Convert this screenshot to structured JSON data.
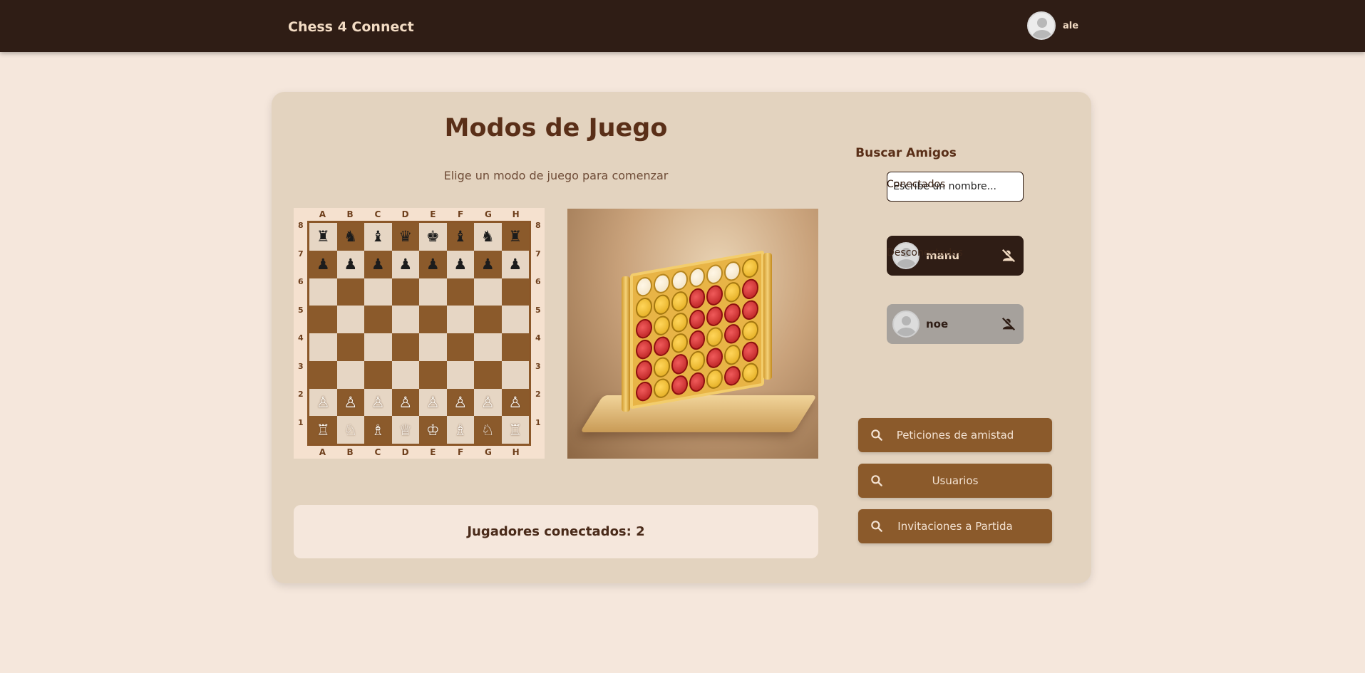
{
  "navbar": {
    "brand": "Chess 4 Connect",
    "user_name": "ale"
  },
  "main": {
    "title": "Modos de Juego",
    "subtitle": "Elige un modo de juego para comenzar",
    "status": "Jugadores conectados: 2",
    "chess": {
      "files": [
        "A",
        "B",
        "C",
        "D",
        "E",
        "F",
        "G",
        "H"
      ],
      "ranks": [
        "8",
        "7",
        "6",
        "5",
        "4",
        "3",
        "2",
        "1"
      ],
      "rows": [
        [
          "♜",
          "♞",
          "♝",
          "♛",
          "♚",
          "♝",
          "♞",
          "♜"
        ],
        [
          "♟",
          "♟",
          "♟",
          "♟",
          "♟",
          "♟",
          "♟",
          "♟"
        ],
        [
          "",
          "",
          "",
          "",
          "",
          "",
          "",
          ""
        ],
        [
          "",
          "",
          "",
          "",
          "",
          "",
          "",
          ""
        ],
        [
          "",
          "",
          "",
          "",
          "",
          "",
          "",
          ""
        ],
        [
          "",
          "",
          "",
          "",
          "",
          "",
          "",
          ""
        ],
        [
          "♙",
          "♙",
          "♙",
          "♙",
          "♙",
          "♙",
          "♙",
          "♙"
        ],
        [
          "♖",
          "♘",
          "♗",
          "♕",
          "♔",
          "♗",
          "♘",
          "♖"
        ]
      ]
    },
    "connect4": {
      "rows": [
        [
          "e",
          "e",
          "e",
          "e",
          "e",
          "e",
          "y"
        ],
        [
          "y",
          "y",
          "y",
          "r",
          "r",
          "y",
          "r"
        ],
        [
          "r",
          "y",
          "y",
          "r",
          "r",
          "r",
          "r"
        ],
        [
          "r",
          "r",
          "y",
          "r",
          "y",
          "r",
          "y"
        ],
        [
          "r",
          "y",
          "r",
          "y",
          "r",
          "y",
          "r"
        ],
        [
          "r",
          "y",
          "r",
          "r",
          "y",
          "r",
          "y"
        ]
      ]
    }
  },
  "friends": {
    "title": "Buscar Amigos",
    "search_placeholder": "Escribe un nombre...",
    "connected_label": "Conectados",
    "disconnected_label": "Desconectados",
    "connected": [
      {
        "name": "manu"
      }
    ],
    "disconnected": [
      {
        "name": "noe"
      }
    ]
  },
  "actions": [
    {
      "label": "Peticiones de amistad",
      "icon": "search-icon"
    },
    {
      "label": "Usuarios",
      "icon": "search-icon"
    },
    {
      "label": "Invitaciones a Partida",
      "icon": "search-icon"
    }
  ],
  "colors": {
    "navbar": "#2f1d15",
    "background": "#f5e7dc",
    "card": "#e3d3bf",
    "accent": "#8b5a2b"
  }
}
